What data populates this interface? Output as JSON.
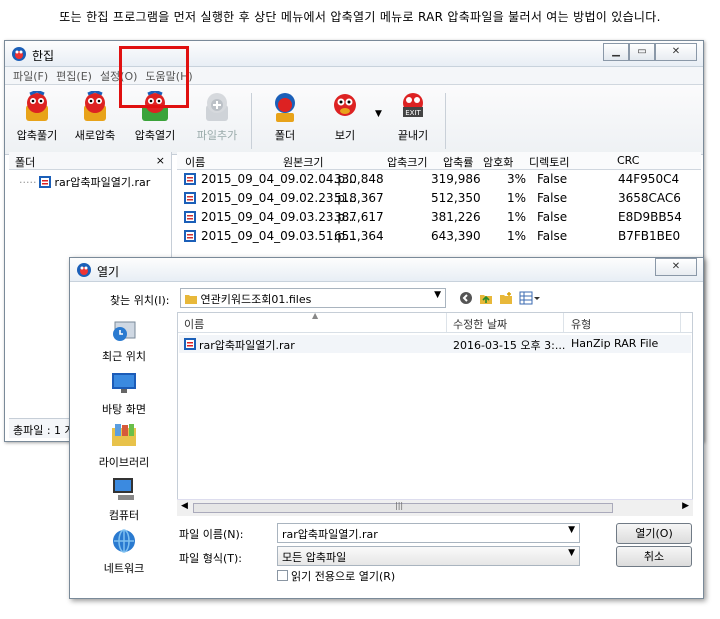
{
  "caption": "또는 한집 프로그램을 먼저 실행한 후 상단 메뉴에서 압축열기 메뉴로 RAR 압축파일을 불러서 여는 방법이 있습니다.",
  "main_window": {
    "title": "한집",
    "menu": [
      "파일(F)",
      "편집(E)",
      "설정(O)",
      "도움말(H)"
    ],
    "toolbar": {
      "compress": "압축풀기",
      "new_compress": "새로압축",
      "open_archive": "압축열기",
      "add_file": "파일추가",
      "folder": "폴더",
      "view": "보기",
      "exit": "끝내기"
    },
    "folder_pane": {
      "header": "폴더",
      "close": "×",
      "tree_item": "rar압축파일열기.rar"
    },
    "status": "총파일 : 1 개",
    "columns": [
      "이름",
      "원본크기",
      "압축크기",
      "압축률",
      "암호화",
      "디렉토리",
      "CRC"
    ],
    "files": [
      {
        "name": "2015_09_04_09.02.04.p...",
        "orig": "330,848",
        "comp": "319,986",
        "ratio": "3%",
        "enc": "False",
        "crc": "44F950C4"
      },
      {
        "name": "2015_09_04_09.02.23.p...",
        "orig": "518,367",
        "comp": "512,350",
        "ratio": "1%",
        "enc": "False",
        "crc": "3658CAC6"
      },
      {
        "name": "2015_09_04_09.03.23.p...",
        "orig": "387,617",
        "comp": "381,226",
        "ratio": "1%",
        "enc": "False",
        "crc": "E8D9BB54"
      },
      {
        "name": "2015_09_04_09.03.51.p...",
        "orig": "651,364",
        "comp": "643,390",
        "ratio": "1%",
        "enc": "False",
        "crc": "B7FB1BE0"
      }
    ]
  },
  "open_dialog": {
    "title": "열기",
    "look_in_label": "찾는 위치(I):",
    "look_in_value": "연관키워드조회01.files",
    "places": [
      "최근 위치",
      "바탕 화면",
      "라이브러리",
      "컴퓨터",
      "네트워크"
    ],
    "columns": [
      "이름",
      "수정한 날짜",
      "유형"
    ],
    "file": {
      "name": "rar압축파일열기.rar",
      "date": "2016-03-15 오후 3:...",
      "type": "HanZip RAR File"
    },
    "filename_label": "파일 이름(N):",
    "filename_value": "rar압축파일열기.rar",
    "filetype_label": "파일 형식(T):",
    "filetype_value": "모든 압축파일",
    "readonly_label": "읽기 전용으로 열기(R)",
    "open_button": "열기(O)",
    "cancel_button": "취소"
  }
}
